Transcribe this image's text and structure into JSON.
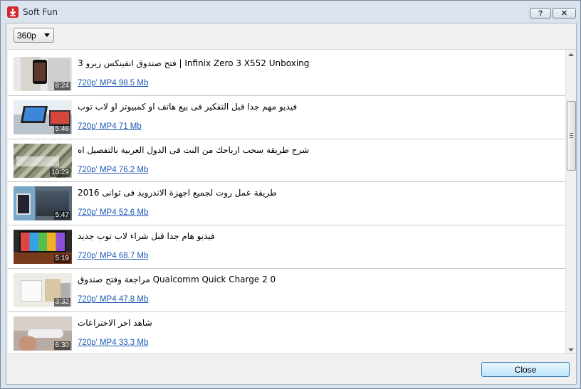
{
  "window": {
    "title": "Soft Fun",
    "help_label": "?",
    "close_label": "✕"
  },
  "quality": {
    "selected": "360p"
  },
  "videos": [
    {
      "title": "فتح صندوق انفينكس زيرو 3 | Infinix Zero 3 X552 Unboxing",
      "duration": "8:24",
      "download": "720p' MP4 98.5 Mb"
    },
    {
      "title": "فيديو مهم جدا قبل التفكير فى بيع هاتف او كمبيوتر او لاب توب",
      "duration": "5:46",
      "download": "720p' MP4 71 Mb"
    },
    {
      "title": "شرح طريقة سحب ارباحك من النت فى الدول العربية بالتفصيل اه",
      "duration": "10:29",
      "download": "720p' MP4 76.2 Mb"
    },
    {
      "title": "طريقة عمل روت لجميع اجهزة الاندرويد فى ثوانى 2016",
      "duration": "5:47",
      "download": "720p' MP4 52.6 Mb"
    },
    {
      "title": "فيديو هام جدا قبل شراء لاب توب جديد",
      "duration": "5:19",
      "download": "720p' MP4 68.7 Mb"
    },
    {
      "title": "مراجعة وفتح صندوق Qualcomm Quick Charge 2 0",
      "duration": "3:32",
      "download": "720p' MP4 47.8 Mb"
    },
    {
      "title": "شاهد اخر الاختراعات",
      "duration": "6:30",
      "download": "720p' MP4 33.3 Mb"
    }
  ],
  "footer": {
    "close_label": "Close"
  },
  "colors": {
    "link": "#1a57b4",
    "app_icon": "#d4262b"
  }
}
